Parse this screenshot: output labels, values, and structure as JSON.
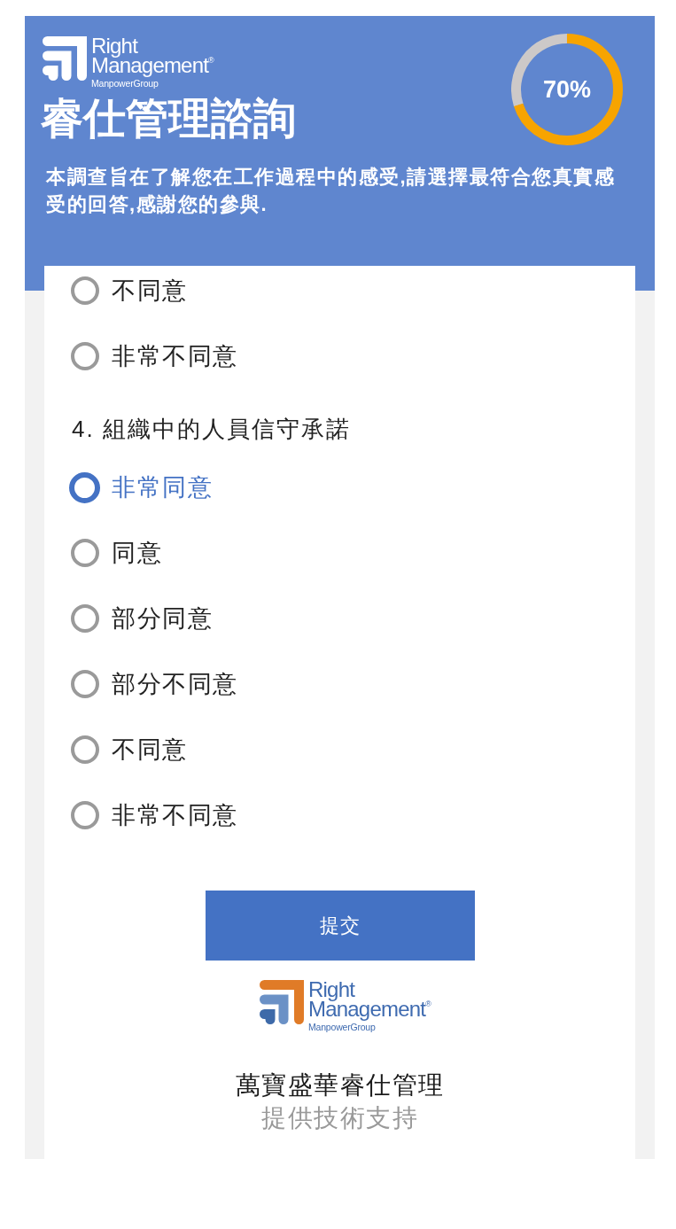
{
  "header": {
    "logo": {
      "wordmark": [
        "Right",
        "Management$^{®}$"
      ],
      "tagline": "ManpowerGroup"
    },
    "title": "睿仕管理諮詢",
    "progress": {
      "level": 0.7,
      "reading": "70%"
    },
    "description": "本調查旨在了解您在工作過程中的感受,請選擇最符合您真實感受的回答,感謝您的參與."
  },
  "questions": [
    {
      "options": [
        {
          "label": "不同意",
          "selected": false
        },
        {
          "label": "非常不同意",
          "selected": false
        }
      ]
    },
    {
      "prompt": "4. 組織中的人員信守承諾",
      "options": [
        {
          "label": "非常同意",
          "selected": true
        },
        {
          "label": "同意",
          "selected": false
        },
        {
          "label": "部分同意",
          "selected": false
        },
        {
          "label": "部分不同意",
          "selected": false
        },
        {
          "label": "不同意",
          "selected": false
        },
        {
          "label": "非常不同意",
          "selected": false
        }
      ]
    }
  ],
  "submit_button": "提交",
  "footer": {
    "logo": {
      "wordmark": [
        "Right",
        "Management$^{®}$"
      ],
      "tagline": "ManpowerGroup"
    },
    "company": "萬寶盛華睿仕管理",
    "note": "提供技術支持"
  }
}
